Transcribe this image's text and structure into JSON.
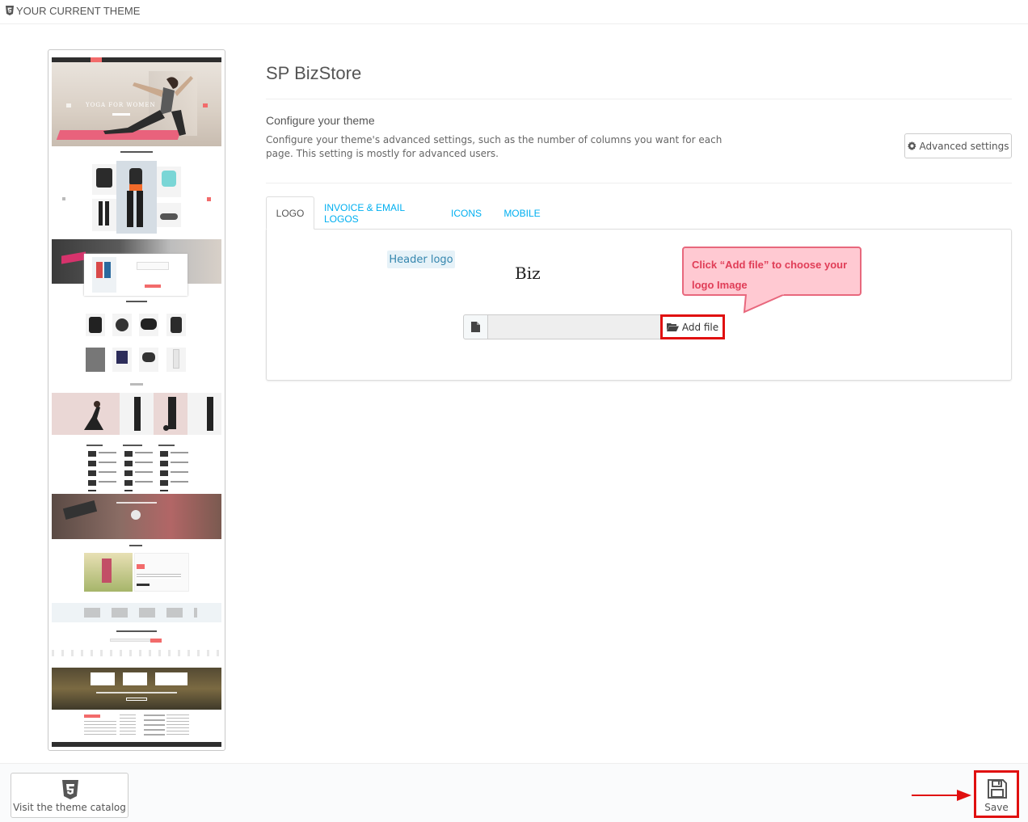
{
  "header": {
    "title": "YOUR CURRENT THEME"
  },
  "preview": {
    "hero_text": "YOGA FOR WOMEN",
    "colors": {
      "accent": "#f26b6b",
      "dark": "#3a3a3a"
    }
  },
  "theme": {
    "name": "SP BizStore",
    "configure_title": "Configure your theme",
    "configure_description": "Configure your theme's advanced settings, such as the number of columns you want for each page. This setting is mostly for advanced users.",
    "advanced_button": "Advanced settings"
  },
  "tabs": [
    {
      "label": "LOGO",
      "active": true
    },
    {
      "label": "INVOICE & EMAIL LOGOS",
      "active": false
    },
    {
      "label": "ICONS",
      "active": false
    },
    {
      "label": "MOBILE",
      "active": false
    }
  ],
  "logo_tab": {
    "header_logo_label": "Header logo",
    "current_logo_text": "Biz",
    "file_input_value": "",
    "add_file_button": "Add file"
  },
  "callout": {
    "line1": "Click “Add file” to choose your",
    "line2": "logo Image"
  },
  "footer": {
    "catalog_button": "Visit the theme catalog",
    "save_button": "Save"
  },
  "colors": {
    "link": "#00aff0",
    "highlight": "#e01010",
    "callout_bg": "#ffc9d2",
    "callout_text": "#e03d57"
  }
}
